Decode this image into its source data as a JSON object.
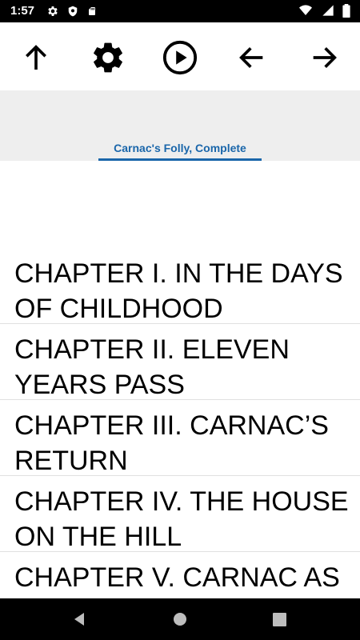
{
  "status_bar": {
    "time": "1:57",
    "left_icons": [
      "gear-icon",
      "shield-icon",
      "sd-card-icon"
    ],
    "right_icons": [
      "wifi-icon",
      "cellular-signal-icon",
      "battery-icon"
    ]
  },
  "toolbar": {
    "buttons": [
      "arrow-up-icon",
      "settings-gear-icon",
      "play-circle-icon",
      "arrow-left-icon",
      "arrow-right-icon"
    ]
  },
  "tabs": {
    "active_label": "Carnac's Folly, Complete",
    "accent_color": "#1a66aa"
  },
  "chapters": [
    {
      "title": "CHAPTER I. IN THE DAYS OF CHILDHOOD"
    },
    {
      "title": "CHAPTER II. ELEVEN YEARS PASS"
    },
    {
      "title": "CHAPTER III. CARNAC’S RETURN"
    },
    {
      "title": "CHAPTER IV. THE HOUSE ON THE HILL"
    },
    {
      "title": "CHAPTER V. CARNAC AS"
    }
  ],
  "nav_bar": {
    "buttons": [
      "back-triangle-icon",
      "home-circle-icon",
      "recents-square-icon"
    ]
  }
}
